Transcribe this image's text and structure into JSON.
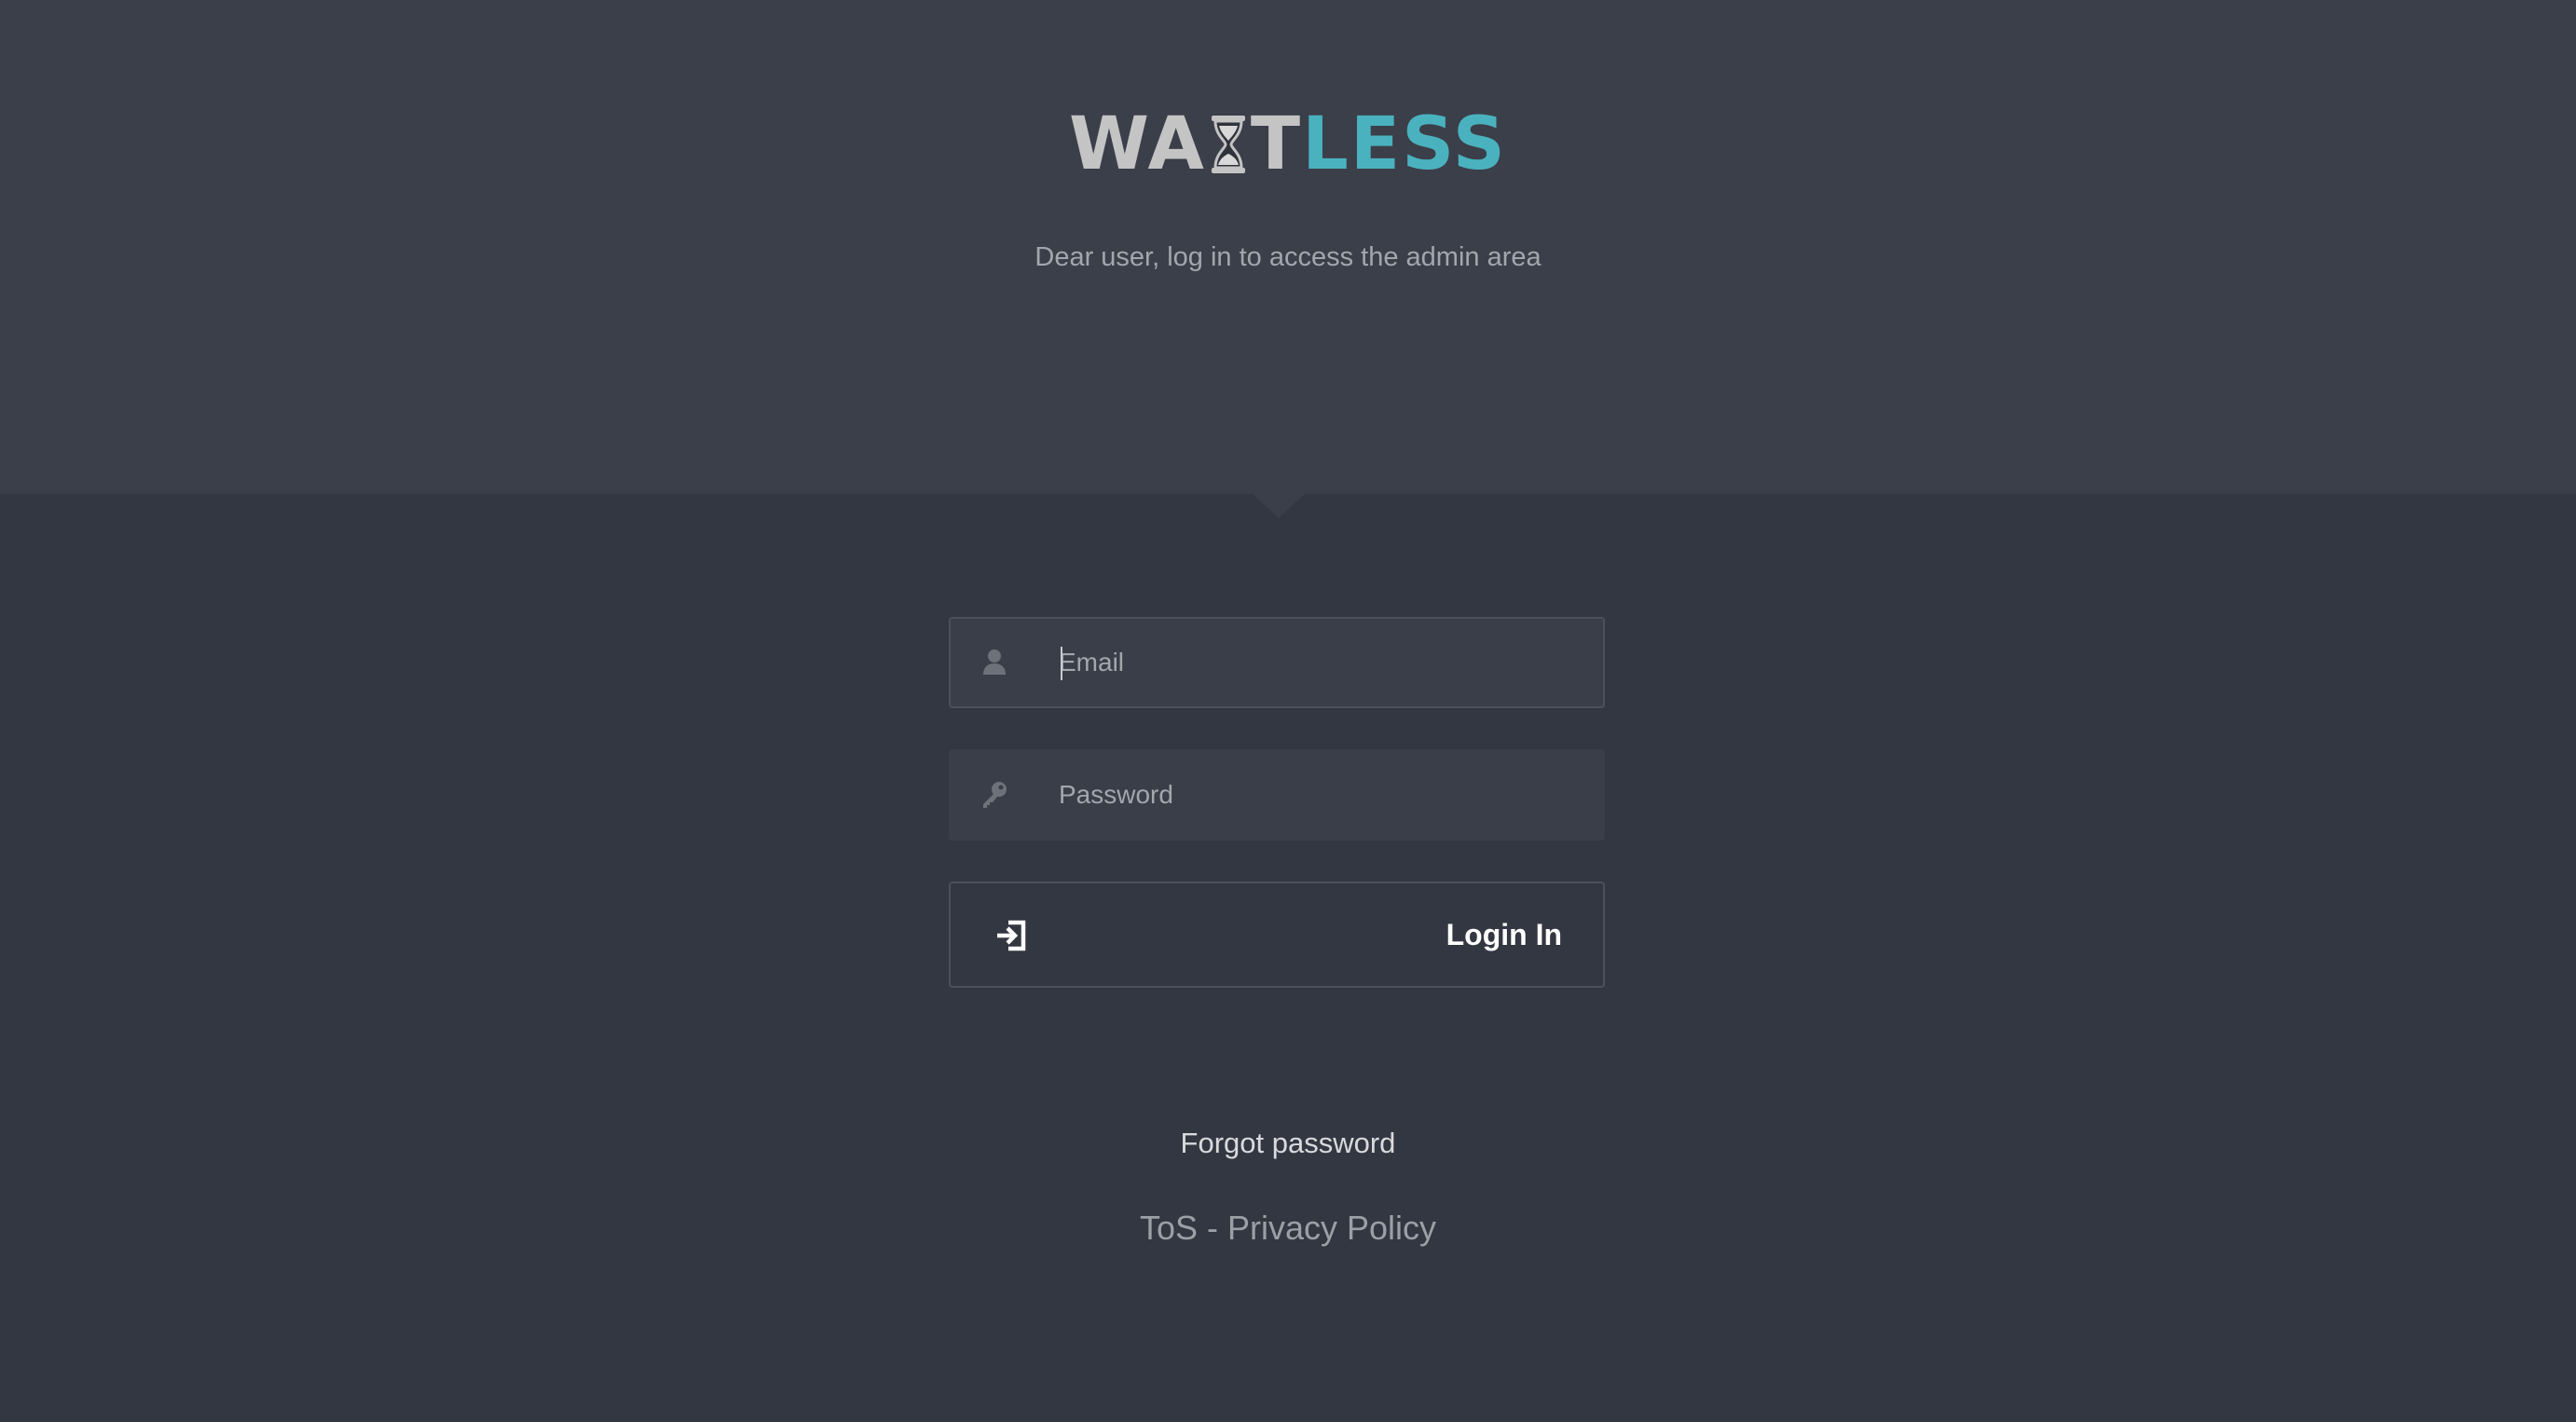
{
  "brand": {
    "logo_part1": "WA",
    "logo_part2": "T",
    "logo_part3": "LESS",
    "logo_color_grey": "#c4c4c4",
    "logo_color_accent": "#4ab2be"
  },
  "header": {
    "subtitle": "Dear user, log in to access the admin area"
  },
  "form": {
    "email_placeholder": "Email",
    "email_value": "",
    "email_icon": "user-icon",
    "password_placeholder": "Password",
    "password_value": "",
    "password_icon": "key-icon",
    "login_label": "Login In",
    "login_icon": "sign-in-icon"
  },
  "links": {
    "forgot_password": "Forgot password",
    "tos": "ToS",
    "separator": " - ",
    "privacy": "Privacy Policy"
  },
  "colors": {
    "header_bg": "#3b3f4a",
    "page_bg": "#333741",
    "input_bg": "#3a3e49"
  }
}
